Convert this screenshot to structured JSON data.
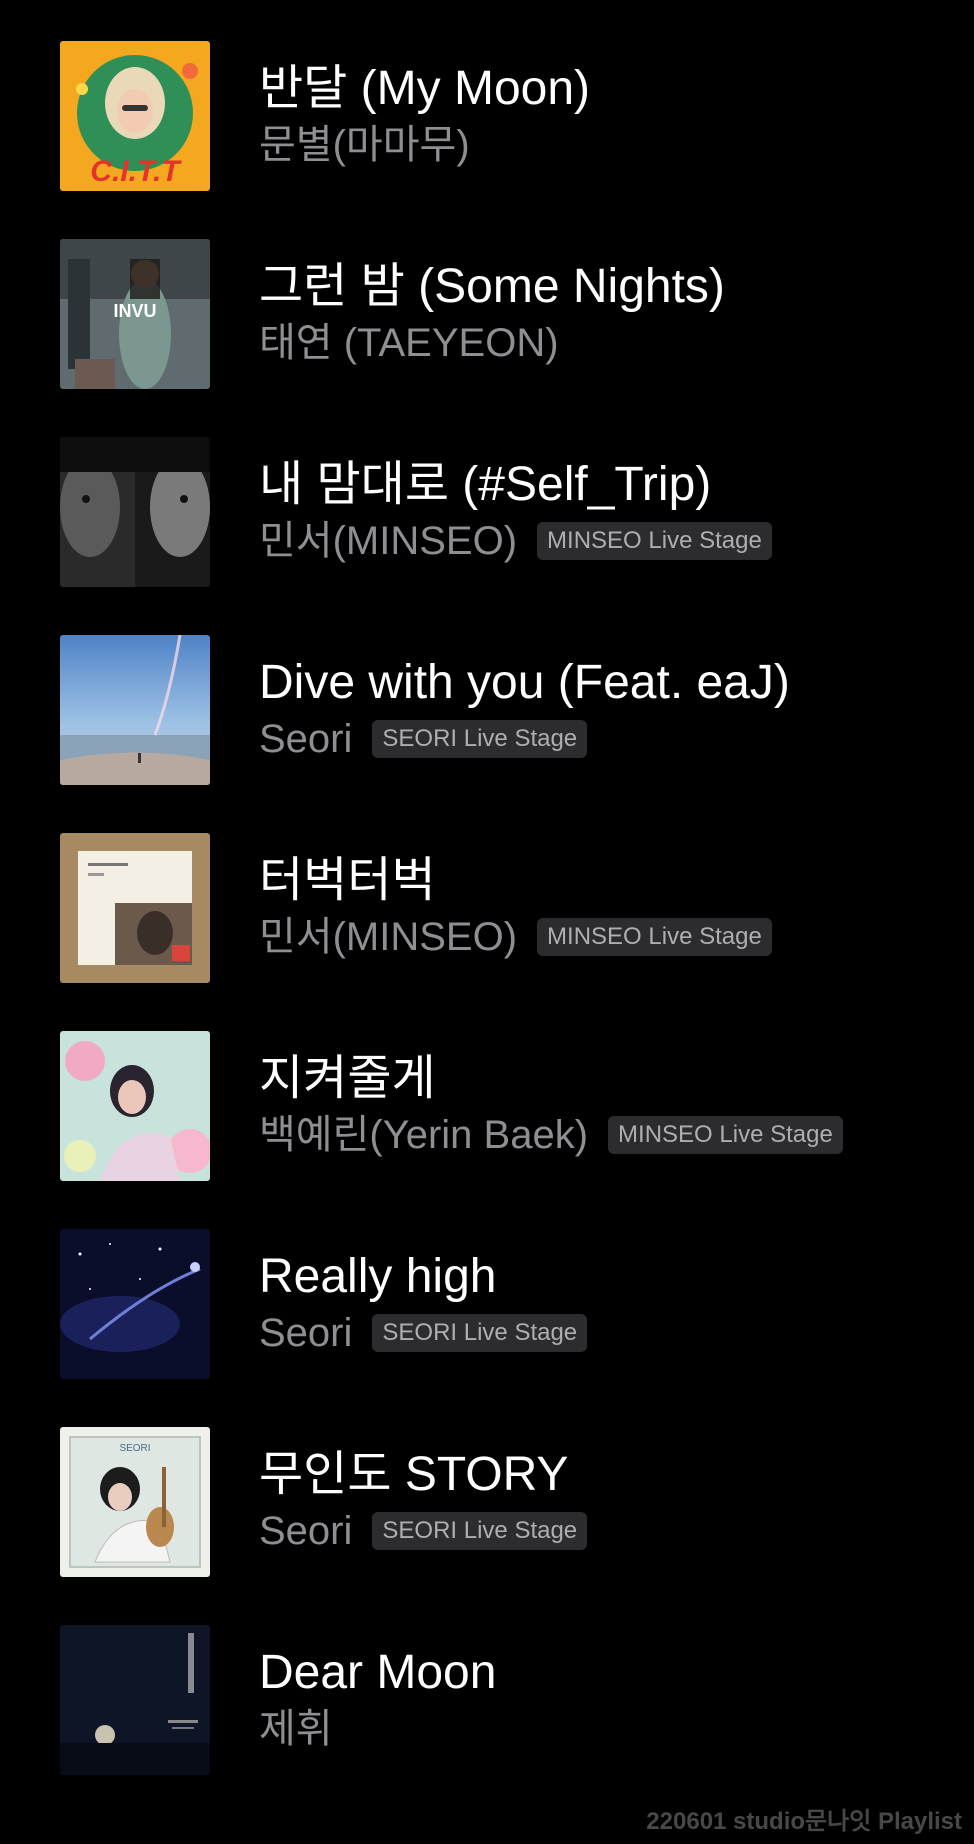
{
  "tracks": [
    {
      "title": "반달 (My Moon)",
      "artist": "문별(마마무)",
      "badge": "",
      "art": "cover-citt",
      "art_text": "C.I.T.T"
    },
    {
      "title": "그런 밤 (Some Nights)",
      "artist": "태연 (TAEYEON)",
      "badge": "",
      "art": "cover-invu",
      "art_text": "INVU"
    },
    {
      "title": "내 맘대로 (#Self_Trip)",
      "artist": "민서(MINSEO)",
      "badge": "MINSEO Live Stage",
      "art": "cover-faces",
      "art_text": ""
    },
    {
      "title": "Dive with you (Feat. eaJ)",
      "artist": "Seori",
      "badge": "SEORI Live Stage",
      "art": "cover-sea",
      "art_text": ""
    },
    {
      "title": "터벅터벅",
      "artist": "민서(MINSEO)",
      "badge": "MINSEO Live Stage",
      "art": "cover-photo",
      "art_text": ""
    },
    {
      "title": "지켜줄게",
      "artist": "백예린(Yerin Baek)",
      "badge": "MINSEO Live Stage",
      "art": "cover-flowers",
      "art_text": ""
    },
    {
      "title": "Really high",
      "artist": "Seori",
      "badge": "SEORI Live Stage",
      "art": "cover-night",
      "art_text": ""
    },
    {
      "title": "무인도 STORY",
      "artist": "Seori",
      "badge": "SEORI Live Stage",
      "art": "cover-guitar",
      "art_text": "SEORI"
    },
    {
      "title": "Dear Moon",
      "artist": "제휘",
      "badge": "",
      "art": "cover-moon",
      "art_text": ""
    }
  ],
  "footer": "220601 studio문나잇 Playlist"
}
